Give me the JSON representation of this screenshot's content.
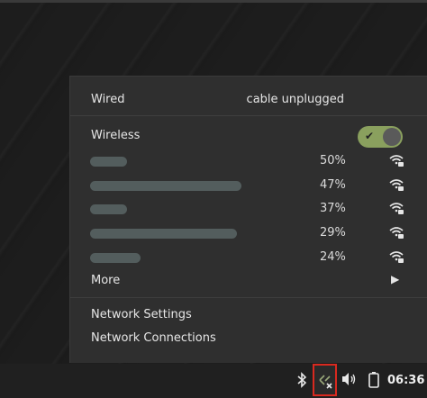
{
  "menu": {
    "wired": {
      "label": "Wired",
      "status": "cable unplugged"
    },
    "wireless": {
      "label": "Wireless",
      "toggle_on": true
    },
    "networks": [
      {
        "strength": "50%"
      },
      {
        "strength": "47%"
      },
      {
        "strength": "37%"
      },
      {
        "strength": "29%"
      },
      {
        "strength": "24%"
      }
    ],
    "more_label": "More",
    "network_settings_label": "Network Settings",
    "network_connections_label": "Network Connections"
  },
  "panel": {
    "clock": "06:36",
    "icons": [
      "bluetooth-icon",
      "network-disconnected-icon",
      "volume-icon",
      "battery-icon"
    ]
  },
  "colors": {
    "toggle_accent": "#8aa05e",
    "highlight_border": "#d9291f"
  }
}
